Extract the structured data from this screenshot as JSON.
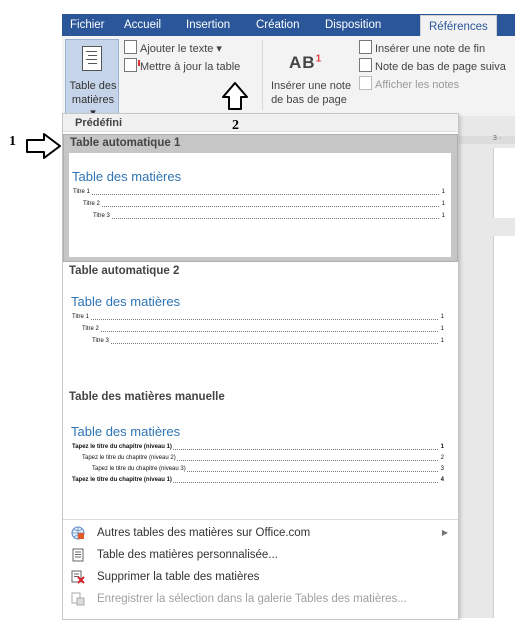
{
  "ribbon": {
    "tabs": [
      {
        "label": "Fichier",
        "active": false
      },
      {
        "label": "Accueil",
        "active": false
      },
      {
        "label": "Insertion",
        "active": false
      },
      {
        "label": "Création",
        "active": false
      },
      {
        "label": "Disposition",
        "active": false
      },
      {
        "label": "Références",
        "active": true
      }
    ],
    "toc_button": {
      "line1": "Table des",
      "line2": "matières ▾"
    },
    "add_text": "Ajouter le texte ▾",
    "update_table": "Mettre à jour la table",
    "insert_footnote": {
      "line1": "Insérer une note",
      "line2": "de bas de page"
    },
    "footnote_icon_text": "AB",
    "footnote_icon_sup": "1",
    "insert_endnote": "Insérer une note de fin",
    "next_footnote": "Note de bas de page suiva",
    "show_notes": "Afficher les notes",
    "ruler_number": "3 ·"
  },
  "annotations": {
    "label1": "1",
    "label2": "2"
  },
  "dropdown": {
    "section_header": "Prédéfini",
    "items": [
      {
        "title": "Table automatique 1",
        "preview_title": "Table des matières",
        "entries": [
          {
            "text": "Titre 1",
            "page": "1"
          },
          {
            "text": "Titre 2",
            "page": "1"
          },
          {
            "text": "Titre 3",
            "page": "1"
          }
        ]
      },
      {
        "title": "Table automatique 2",
        "preview_title": "Table des matières",
        "entries": [
          {
            "text": "Titre 1",
            "page": "1"
          },
          {
            "text": "Titre 2",
            "page": "1"
          },
          {
            "text": "Titre 3",
            "page": "1"
          }
        ]
      },
      {
        "title": "Table des matières manuelle",
        "preview_title": "Table des matières",
        "entries": [
          {
            "text": "Tapez le titre du chapitre (niveau 1)",
            "page": "1"
          },
          {
            "text": "Tapez le titre du chapitre (niveau 2)",
            "page": "2"
          },
          {
            "text": "Tapez le titre du chapitre (niveau 3)",
            "page": "3"
          },
          {
            "text": "Tapez le titre du chapitre (niveau 1)",
            "page": "4"
          }
        ]
      }
    ],
    "menu": [
      {
        "label": "Autres tables des matières sur Office.com",
        "disabled": false,
        "submenu": true
      },
      {
        "label": "Table des matières personnalisée...",
        "disabled": false,
        "submenu": false
      },
      {
        "label": "Supprimer la table des matières",
        "disabled": false,
        "submenu": false
      },
      {
        "label": "Enregistrer la sélection dans la galerie Tables des matières...",
        "disabled": true,
        "submenu": false
      }
    ]
  }
}
